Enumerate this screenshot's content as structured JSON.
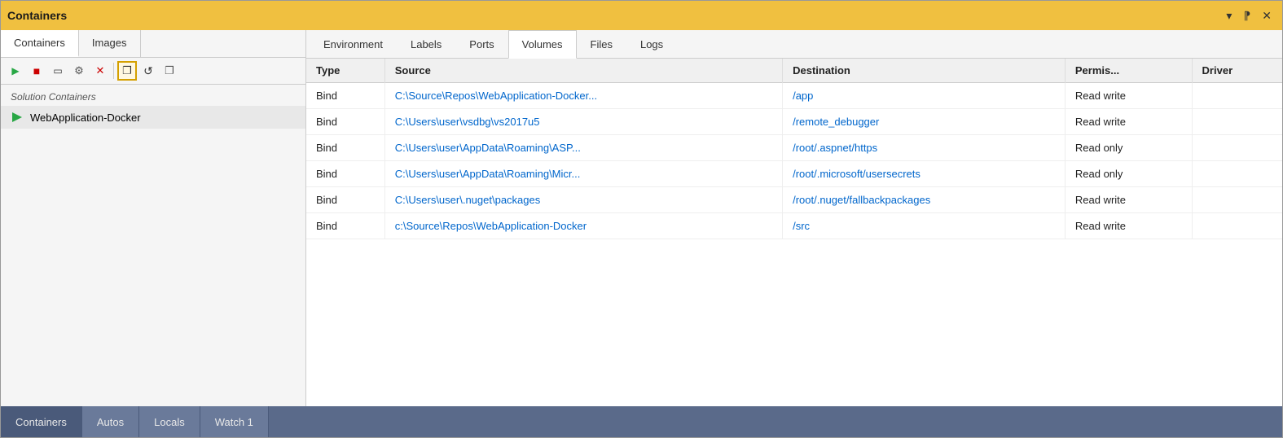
{
  "window": {
    "title": "Containers",
    "controls": [
      "▾",
      "⁋",
      "✕"
    ]
  },
  "left_panel": {
    "tabs": [
      {
        "label": "Containers",
        "active": true
      },
      {
        "label": "Images",
        "active": false
      }
    ],
    "toolbar_buttons": [
      {
        "id": "play",
        "symbol": "▶",
        "title": "Start",
        "highlighted": false
      },
      {
        "id": "stop",
        "symbol": "■",
        "title": "Stop",
        "highlighted": false
      },
      {
        "id": "terminal",
        "symbol": "▭",
        "title": "Open Terminal",
        "highlighted": false
      },
      {
        "id": "settings",
        "symbol": "⚙",
        "title": "Settings",
        "highlighted": false
      },
      {
        "id": "delete",
        "symbol": "✕",
        "title": "Delete",
        "highlighted": false
      },
      {
        "id": "copy",
        "symbol": "❐",
        "title": "Copy",
        "highlighted": true
      },
      {
        "id": "refresh",
        "symbol": "↺",
        "title": "Refresh",
        "highlighted": false
      },
      {
        "id": "copy2",
        "symbol": "❐",
        "title": "Copy All",
        "highlighted": false
      }
    ],
    "solution_label": "Solution Containers",
    "containers": [
      {
        "name": "WebApplication-Docker",
        "running": true
      }
    ]
  },
  "right_panel": {
    "detail_tabs": [
      {
        "label": "Environment",
        "active": false
      },
      {
        "label": "Labels",
        "active": false
      },
      {
        "label": "Ports",
        "active": false
      },
      {
        "label": "Volumes",
        "active": true
      },
      {
        "label": "Files",
        "active": false
      },
      {
        "label": "Logs",
        "active": false
      }
    ],
    "table": {
      "columns": [
        {
          "key": "type",
          "label": "Type"
        },
        {
          "key": "source",
          "label": "Source"
        },
        {
          "key": "destination",
          "label": "Destination"
        },
        {
          "key": "permissions",
          "label": "Permis..."
        },
        {
          "key": "driver",
          "label": "Driver"
        }
      ],
      "rows": [
        {
          "type": "Bind",
          "source": "C:\\Source\\Repos\\WebApplication-Docker...",
          "destination": "/app",
          "permissions": "Read write",
          "driver": ""
        },
        {
          "type": "Bind",
          "source": "C:\\Users\\user\\vsdbg\\vs2017u5",
          "destination": "/remote_debugger",
          "permissions": "Read write",
          "driver": ""
        },
        {
          "type": "Bind",
          "source": "C:\\Users\\user\\AppData\\Roaming\\ASP...",
          "destination": "/root/.aspnet/https",
          "permissions": "Read only",
          "driver": ""
        },
        {
          "type": "Bind",
          "source": "C:\\Users\\user\\AppData\\Roaming\\Micr...",
          "destination": "/root/.microsoft/usersecrets",
          "permissions": "Read only",
          "driver": ""
        },
        {
          "type": "Bind",
          "source": "C:\\Users\\user\\.nuget\\packages",
          "destination": "/root/.nuget/fallbackpackages",
          "permissions": "Read write",
          "driver": ""
        },
        {
          "type": "Bind",
          "source": "c:\\Source\\Repos\\WebApplication-Docker",
          "destination": "/src",
          "permissions": "Read write",
          "driver": ""
        }
      ]
    }
  },
  "status_bar": {
    "tabs": [
      {
        "label": "Containers",
        "active": false
      },
      {
        "label": "Autos",
        "active": false
      },
      {
        "label": "Locals",
        "active": false
      },
      {
        "label": "Watch 1",
        "active": false
      }
    ]
  }
}
